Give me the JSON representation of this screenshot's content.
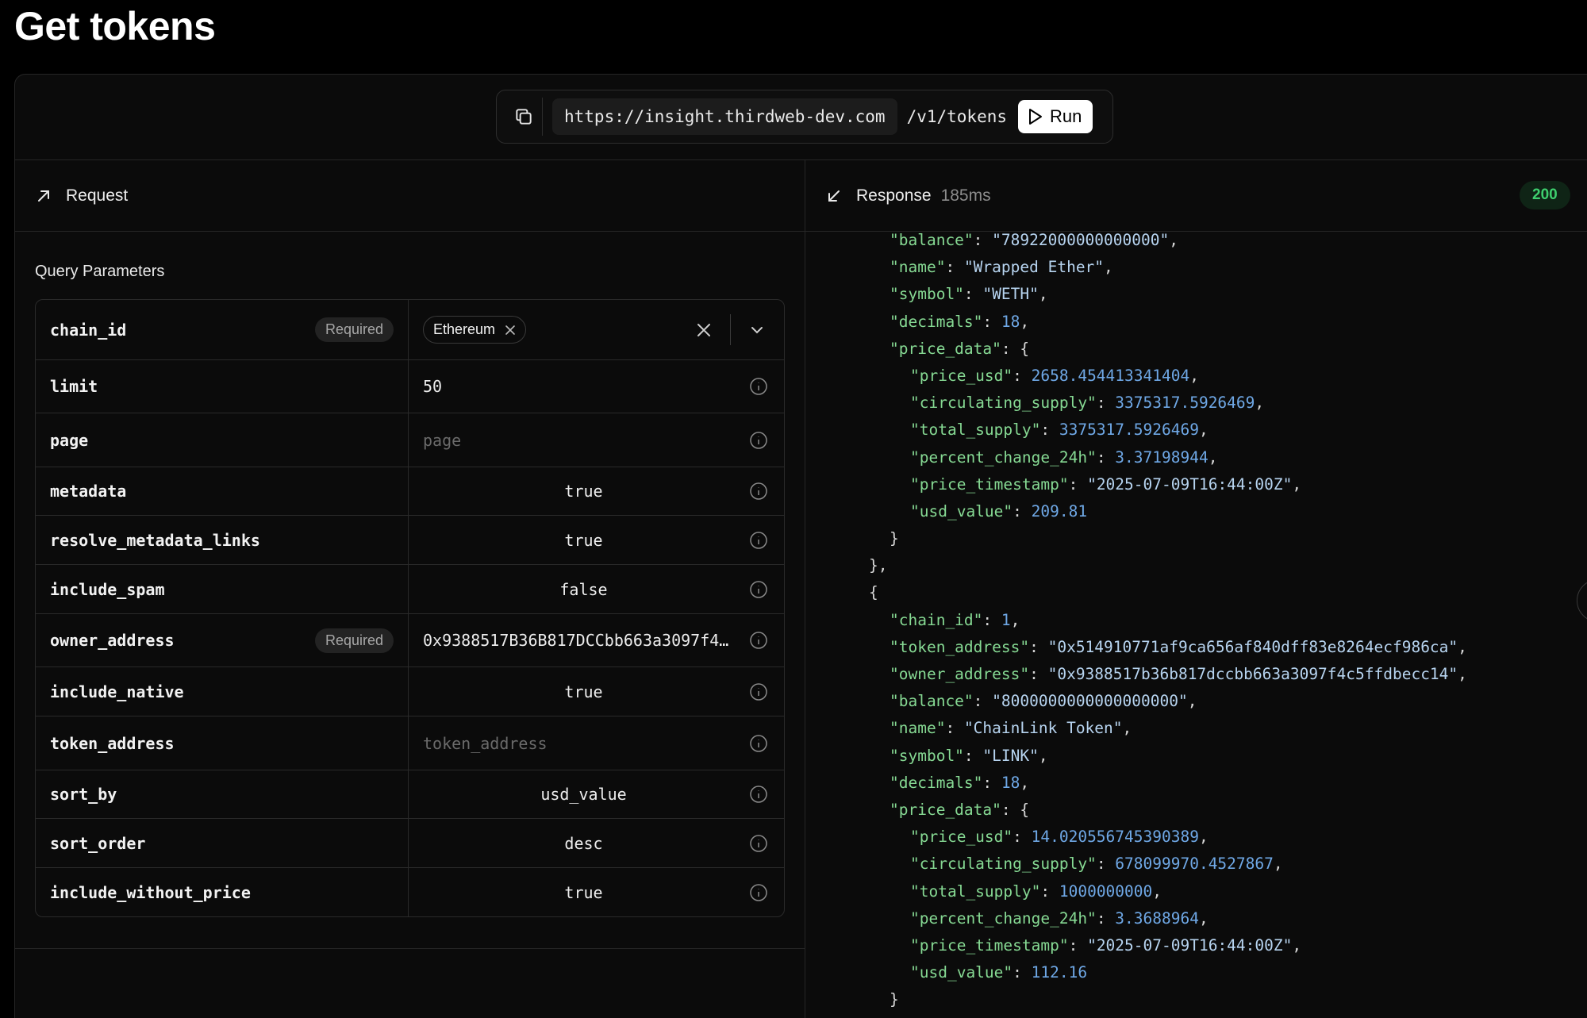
{
  "page": {
    "title": "Get tokens"
  },
  "urlbar": {
    "host": "https://insight.thirdweb-dev.com",
    "path": "/v1/tokens",
    "run_label": "Run"
  },
  "request": {
    "label": "Request",
    "section_title": "Query Parameters"
  },
  "response": {
    "label": "Response",
    "time": "185ms",
    "status": "200"
  },
  "params": {
    "required_label": "Required",
    "chain_id": {
      "name": "chain_id",
      "chip": "Ethereum"
    },
    "limit": {
      "name": "limit",
      "value": "50"
    },
    "page": {
      "name": "page",
      "placeholder": "page"
    },
    "metadata": {
      "name": "metadata",
      "value": "true"
    },
    "resolve_metadata_links": {
      "name": "resolve_metadata_links",
      "value": "true"
    },
    "include_spam": {
      "name": "include_spam",
      "value": "false"
    },
    "owner_address": {
      "name": "owner_address",
      "value": "0x9388517B36B817DCCbb663a3097f4c5ffdbecc14"
    },
    "include_native": {
      "name": "include_native",
      "value": "true"
    },
    "token_address": {
      "name": "token_address",
      "placeholder": "token_address"
    },
    "sort_by": {
      "name": "sort_by",
      "value": "usd_value"
    },
    "sort_order": {
      "name": "sort_order",
      "value": "desc"
    },
    "include_without_price": {
      "name": "include_without_price",
      "value": "true"
    }
  },
  "icons": {
    "copy": "copy-icon",
    "run": "play-icon",
    "request": "arrow-up-right-icon",
    "response": "arrow-down-left-icon",
    "info": "info-icon",
    "clear": "close-icon",
    "chevron": "chevron-down-icon"
  },
  "colors": {
    "json_key": "#86d993",
    "json_string": "#b7d4f0",
    "json_number": "#6fa8e6",
    "status_green": "#3ecf6e"
  },
  "response_body": [
    {
      "indent": 2,
      "key": "balance",
      "str": "78922000000000000",
      "comma": true
    },
    {
      "indent": 2,
      "key": "name",
      "str": "Wrapped Ether",
      "comma": true
    },
    {
      "indent": 2,
      "key": "symbol",
      "str": "WETH",
      "comma": true
    },
    {
      "indent": 2,
      "key": "decimals",
      "num": "18",
      "comma": true
    },
    {
      "indent": 2,
      "key": "price_data",
      "open": "{"
    },
    {
      "indent": 3,
      "key": "price_usd",
      "num": "2658.454413341404",
      "comma": true
    },
    {
      "indent": 3,
      "key": "circulating_supply",
      "num": "3375317.5926469",
      "comma": true
    },
    {
      "indent": 3,
      "key": "total_supply",
      "num": "3375317.5926469",
      "comma": true
    },
    {
      "indent": 3,
      "key": "percent_change_24h",
      "num": "3.37198944",
      "comma": true
    },
    {
      "indent": 3,
      "key": "price_timestamp",
      "str": "2025-07-09T16:44:00Z",
      "comma": true
    },
    {
      "indent": 3,
      "key": "usd_value",
      "num": "209.81"
    },
    {
      "indent": 2,
      "punct": "}"
    },
    {
      "indent": 1,
      "punct": "},"
    },
    {
      "indent": 1,
      "punct": "{"
    },
    {
      "indent": 2,
      "key": "chain_id",
      "num": "1",
      "comma": true
    },
    {
      "indent": 2,
      "key": "token_address",
      "str": "0x514910771af9ca656af840dff83e8264ecf986ca",
      "comma": true
    },
    {
      "indent": 2,
      "key": "owner_address",
      "str": "0x9388517b36b817dccbb663a3097f4c5ffdbecc14",
      "comma": true
    },
    {
      "indent": 2,
      "key": "balance",
      "str": "8000000000000000000",
      "comma": true
    },
    {
      "indent": 2,
      "key": "name",
      "str": "ChainLink Token",
      "comma": true
    },
    {
      "indent": 2,
      "key": "symbol",
      "str": "LINK",
      "comma": true
    },
    {
      "indent": 2,
      "key": "decimals",
      "num": "18",
      "comma": true
    },
    {
      "indent": 2,
      "key": "price_data",
      "open": "{"
    },
    {
      "indent": 3,
      "key": "price_usd",
      "num": "14.020556745390389",
      "comma": true
    },
    {
      "indent": 3,
      "key": "circulating_supply",
      "num": "678099970.4527867",
      "comma": true
    },
    {
      "indent": 3,
      "key": "total_supply",
      "num": "1000000000",
      "comma": true
    },
    {
      "indent": 3,
      "key": "percent_change_24h",
      "num": "3.3688964",
      "comma": true
    },
    {
      "indent": 3,
      "key": "price_timestamp",
      "str": "2025-07-09T16:44:00Z",
      "comma": true
    },
    {
      "indent": 3,
      "key": "usd_value",
      "num": "112.16"
    },
    {
      "indent": 2,
      "punct": "}"
    }
  ]
}
